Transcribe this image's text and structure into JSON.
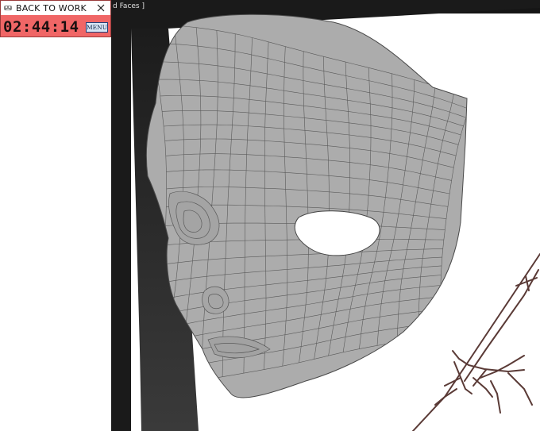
{
  "timer": {
    "title": "BACK TO WORK",
    "time": "02:44:14",
    "menu_label": "MENU",
    "close_icon": "close-icon",
    "app_icon": "timer-app-icon",
    "accent_color": "#f06666"
  },
  "viewport": {
    "header_fragment": "d Faces ]",
    "background_color": "#ffffff",
    "mesh_color": "#acacac",
    "wire_color": "#5a5a5a"
  }
}
